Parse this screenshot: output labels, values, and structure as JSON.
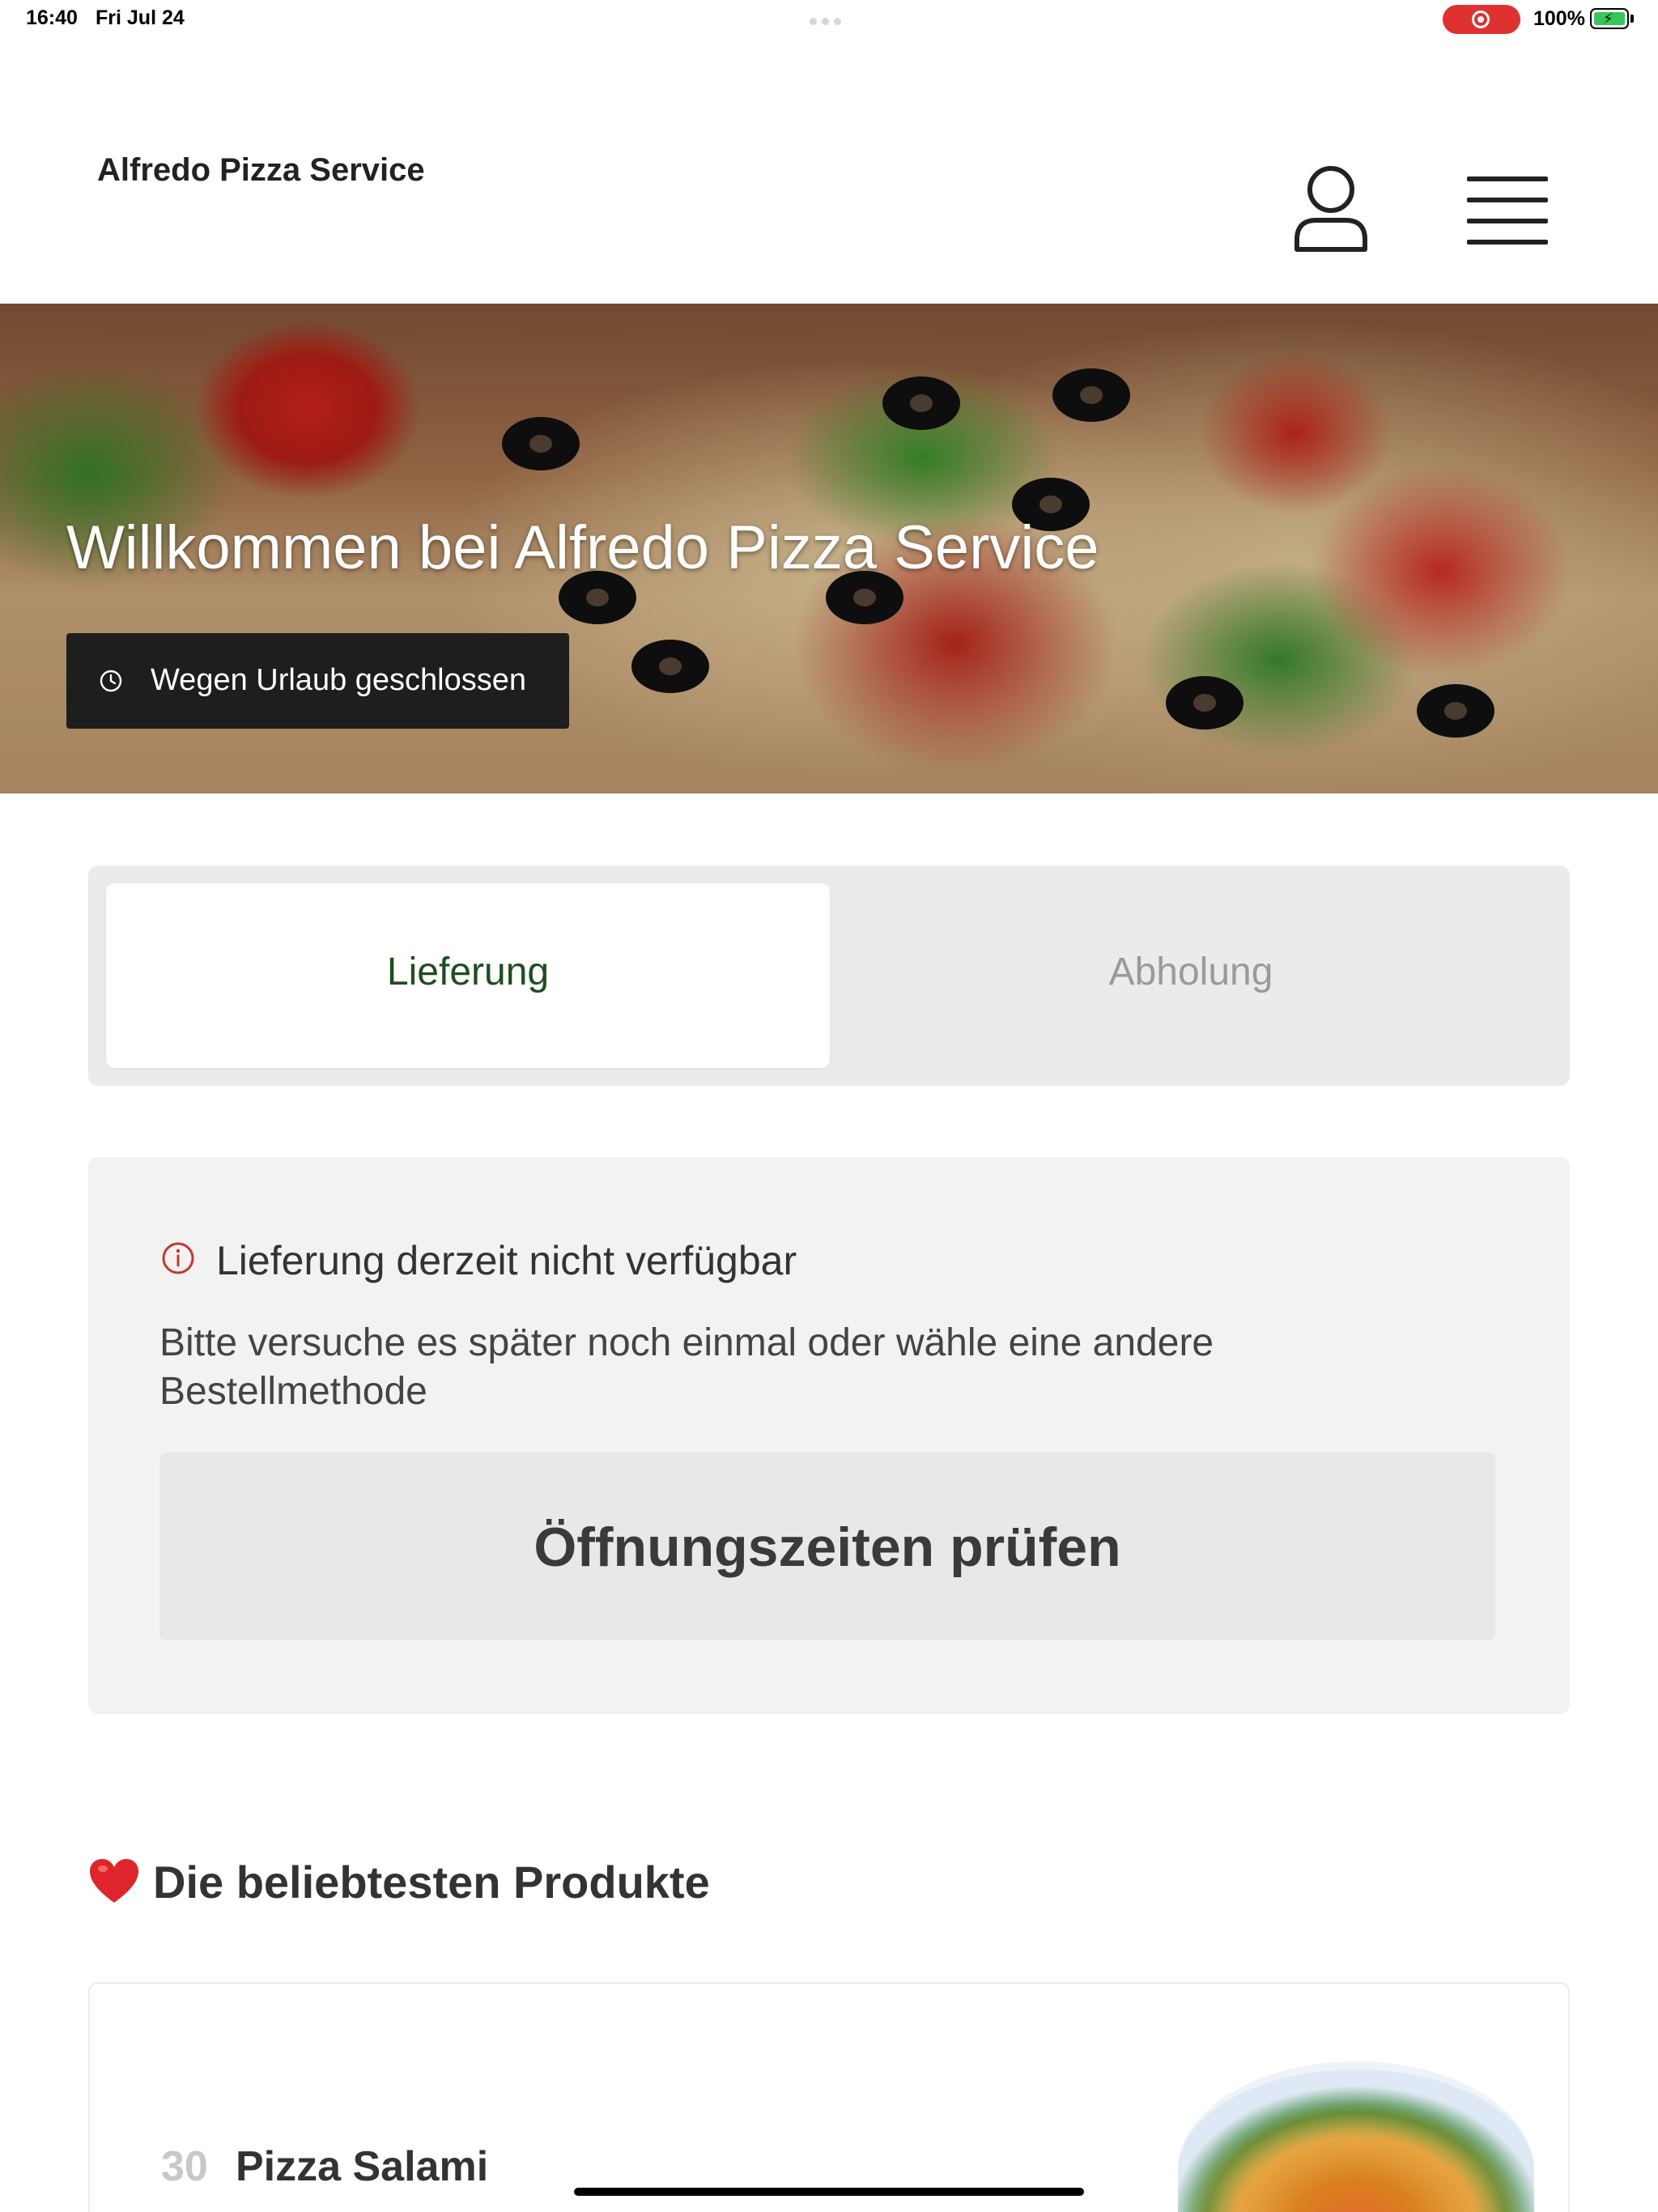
{
  "status_bar": {
    "time": "16:40",
    "date": "Fri Jul 24",
    "battery": "100%",
    "recording_color": "#e03131"
  },
  "header": {
    "brand": "Alfredo Pizza Service",
    "user_icon": "user-icon",
    "menu_icon": "hamburger-menu-icon"
  },
  "hero": {
    "title": "Willkommen bei Alfredo Pizza Service",
    "status_badge": "Wegen Urlaub geschlossen",
    "status_icon": "clock-icon"
  },
  "order_method": {
    "options": [
      {
        "label": "Lieferung",
        "selected": true
      },
      {
        "label": "Abholung",
        "selected": false
      }
    ],
    "active_color": "#1e4d1e"
  },
  "notice": {
    "icon": "info-icon",
    "title": "Lieferung derzeit nicht verfügbar",
    "text": "Bitte versuche es später noch einmal oder wähle eine andere Bestellmethode",
    "button": "Öffnungszeiten prüfen"
  },
  "popular": {
    "icon": "heart-icon",
    "title": "Die beliebtesten Produkte",
    "products": [
      {
        "number": "30",
        "name": "Pizza Salami"
      }
    ]
  }
}
